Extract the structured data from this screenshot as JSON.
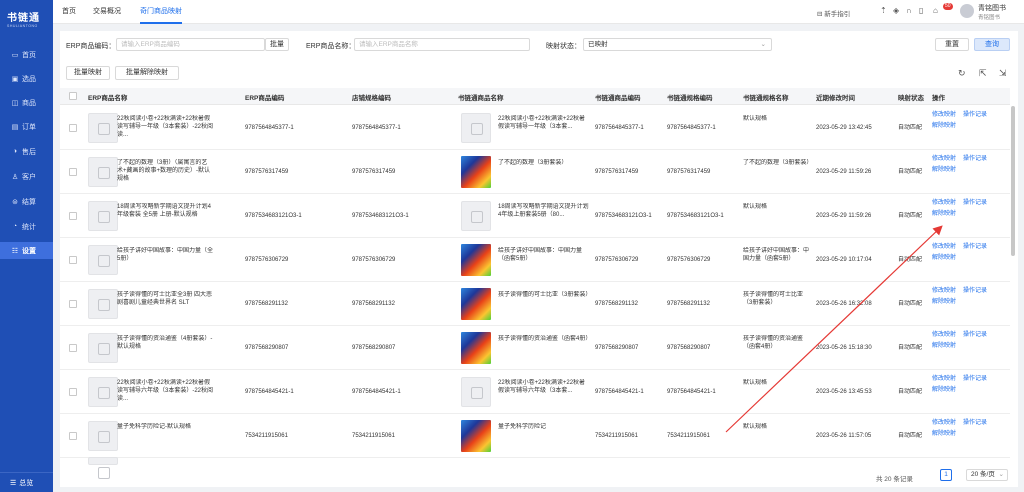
{
  "sidebar": {
    "logo": "书链通",
    "logo_sub": "SHULIANTONG",
    "items": [
      {
        "icon": "monitor-icon",
        "label": "首页"
      },
      {
        "icon": "box-icon",
        "label": "选品"
      },
      {
        "icon": "bag-icon",
        "label": "商品"
      },
      {
        "icon": "order-icon",
        "label": "订单"
      },
      {
        "icon": "return-icon",
        "label": "售后"
      },
      {
        "icon": "user-icon",
        "label": "客户"
      },
      {
        "icon": "settle-icon",
        "label": "结算"
      },
      {
        "icon": "chart-icon",
        "label": "统计"
      },
      {
        "icon": "settings-icon",
        "label": "设置"
      }
    ],
    "menu_label": "总览"
  },
  "topbar": {
    "tabs": [
      "首页",
      "交易概况",
      "奇门商品映射"
    ],
    "guide": "新手指引",
    "badge": "50",
    "user_name": "青铭图书",
    "user_shop": "青铭图书"
  },
  "filters": {
    "erp_code_label": "ERP商品编码：",
    "erp_code_placeholder": "请输入ERP商品编码",
    "batch_label": "批量",
    "erp_name_label": "ERP商品名称：",
    "erp_name_placeholder": "请输入ERP商品名称",
    "mapping_status_label": "映射状态：",
    "mapping_status_value": "已映射",
    "reset": "重置",
    "query": "查询"
  },
  "actions": {
    "batch_map": "批量映射",
    "batch_unmap": "批量解除映射"
  },
  "table": {
    "headers": [
      "ERP商品名称",
      "ERP商品编码",
      "店铺规格编码",
      "书链通商品名称",
      "书链通商品编码",
      "书链通规格编码",
      "书链通规格名称",
      "近期修改时间",
      "映射状态",
      "操作"
    ],
    "op_edit": "修改映射",
    "op_log": "操作记录",
    "op_unmap": "解除映射",
    "rows": [
      {
        "erp_name": "22秋阅读小卷+22秋满读+22秋暑假读写辅导一年级（3本套装）-22秋阅读...",
        "erp_code": "9787564845377-1",
        "shop_code": "9787564845377-1",
        "slt_name": "22秋阅读小卷+22秋满读+22秋暑假读写辅导一年级（3本套...",
        "slt_code": "9787564845377-1",
        "slt_spec_code": "9787564845377-1",
        "slt_spec_name": "默认规格",
        "time": "2023-05-29 13:42:45",
        "status": "自动匹配",
        "img": "placeholder"
      },
      {
        "erp_name": "了不起的数理（3册）（属寓言的艺术+藏画的故事+数理的历史）-默认规格",
        "erp_code": "9787576317459",
        "shop_code": "9787576317459",
        "slt_name": "了不起的数理（3册套装）",
        "slt_code": "9787576317459",
        "slt_spec_code": "9787576317459",
        "slt_spec_name": "了不起的数理（3册套装）",
        "time": "2023-05-29 11:59:26",
        "status": "自动匹配",
        "img": "book"
      },
      {
        "erp_name": "18周读写攻略新学期语文提升计划4年级套装 全5册 上册-默认规格",
        "erp_code": "9787534683121O3-1",
        "shop_code": "9787534683121O3-1",
        "slt_name": "18周读写攻略新学期语文提升计划4年级上册套装5册（80...",
        "slt_code": "9787534683121O3-1",
        "slt_spec_code": "9787534683121O3-1",
        "slt_spec_name": "默认规格",
        "time": "2023-05-29 11:59:26",
        "status": "自动匹配",
        "img": "placeholder"
      },
      {
        "erp_name": "给孩子讲好中国故事：中国力量（全5册）",
        "erp_code": "9787576306729",
        "shop_code": "9787576306729",
        "slt_name": "给孩子讲好中国故事：中国力量（函套5册）",
        "slt_code": "9787576306729",
        "slt_spec_code": "9787576306729",
        "slt_spec_name": "给孩子讲好中国故事：中国力量（函套5册）",
        "time": "2023-05-29 10:17:04",
        "status": "自动匹配",
        "img": "book"
      },
      {
        "erp_name": "孩子读得懂的可士比亚全3册 四大悲剧喜剧儿童经典世界名 SLT",
        "erp_code": "9787568291132",
        "shop_code": "9787568291132",
        "slt_name": "孩子读得懂的可士比亚（3册套装）",
        "slt_code": "9787568291132",
        "slt_spec_code": "9787568291132",
        "slt_spec_name": "孩子读得懂的可士比亚（3册套装）",
        "time": "2023-05-26 16:32:08",
        "status": "自动匹配",
        "img": "book"
      },
      {
        "erp_name": "孩子读得懂的资治通鉴（4册套装）-默认规格",
        "erp_code": "9787568290807",
        "shop_code": "9787568290807",
        "slt_name": "孩子读得懂的资治通鉴（函套4册）",
        "slt_code": "9787568290807",
        "slt_spec_code": "9787568290807",
        "slt_spec_name": "孩子读得懂的资治通鉴（函套4册）",
        "time": "2023-05-26 15:18:30",
        "status": "自动匹配",
        "img": "book"
      },
      {
        "erp_name": "22秋阅读小卷+22秋满读+22秋暑假读写辅导六年级（3本套装）-22秋阅读...",
        "erp_code": "9787564845421-1",
        "shop_code": "9787564845421-1",
        "slt_name": "22秋阅读小卷+22秋满读+22秋暑假读写辅导六年级（3本套...",
        "slt_code": "9787564845421-1",
        "slt_spec_code": "9787564845421-1",
        "slt_spec_name": "默认规格",
        "time": "2023-05-26 13:45:53",
        "status": "自动匹配",
        "img": "placeholder"
      },
      {
        "erp_name": "量子免科学历险记-默认规格",
        "erp_code": "7534211915061",
        "shop_code": "7534211915061",
        "slt_name": "量子免科学历险记",
        "slt_code": "7534211915061",
        "slt_spec_code": "7534211915061",
        "slt_spec_name": "默认规格",
        "time": "2023-05-26 11:57:05",
        "status": "自动匹配",
        "img": "book"
      }
    ]
  },
  "pagination": {
    "total": "共 20 条记录",
    "page": "1",
    "page_size": "20 条/页"
  }
}
